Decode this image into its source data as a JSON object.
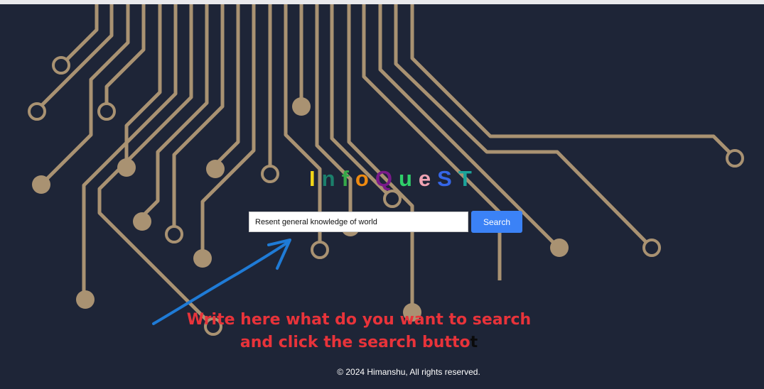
{
  "logo": {
    "letters": [
      {
        "char": "I",
        "color": "#f2d617"
      },
      {
        "char": "n",
        "color": "#1b7f6b"
      },
      {
        "char": "f",
        "color": "#35a849"
      },
      {
        "char": "o",
        "color": "#ee8a10"
      },
      {
        "char": "Q",
        "color": "#7a1a8a"
      },
      {
        "char": "u",
        "color": "#2fcf6a"
      },
      {
        "char": "e",
        "color": "#f0a3b3"
      },
      {
        "char": "S",
        "color": "#3566e8"
      },
      {
        "char": "T",
        "color": "#1ba39a"
      }
    ]
  },
  "search": {
    "value": "Resent general knowledge of world",
    "button_label": "Search"
  },
  "annotation": {
    "line1": "Write here what do you want to search",
    "line2": "and click the search butto",
    "line2_last": "t"
  },
  "footer": {
    "text": "© 2024 Himanshu, All rights reserved."
  },
  "colors": {
    "background": "#1e2537",
    "circuit": "#a99272",
    "button": "#3b82f6",
    "hint_text": "#e8333a",
    "arrow": "#1f7bd6"
  }
}
